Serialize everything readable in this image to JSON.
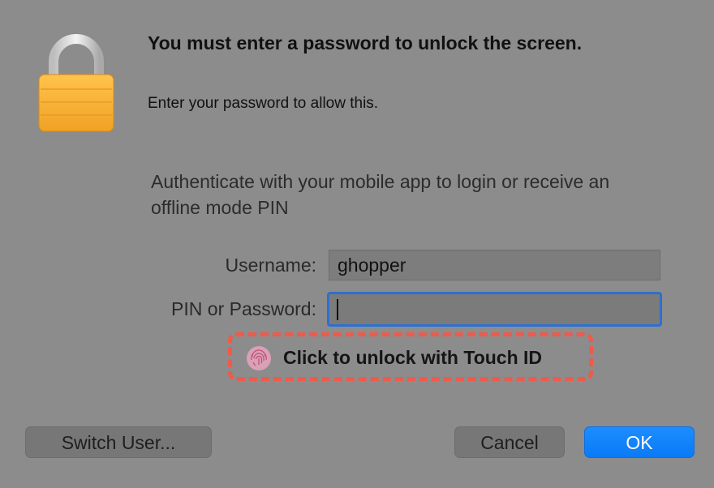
{
  "dialog": {
    "title": "You must enter a password to unlock the screen.",
    "subtitle": "Enter your password to allow this.",
    "auth_message": "Authenticate with your mobile app to login or receive an offline mode PIN",
    "icon": "padlock-icon"
  },
  "form": {
    "username_label": "Username:",
    "username_value": "ghopper",
    "pin_label": "PIN or Password:",
    "pin_value": ""
  },
  "touch_id": {
    "label": "Click to unlock with Touch ID",
    "icon": "fingerprint-icon",
    "highlight_color": "#ef5a4b"
  },
  "buttons": {
    "switch_user": "Switch User...",
    "cancel": "Cancel",
    "ok": "OK"
  },
  "colors": {
    "accent": "#0a7af7",
    "focus_ring": "#2e6fd0"
  }
}
